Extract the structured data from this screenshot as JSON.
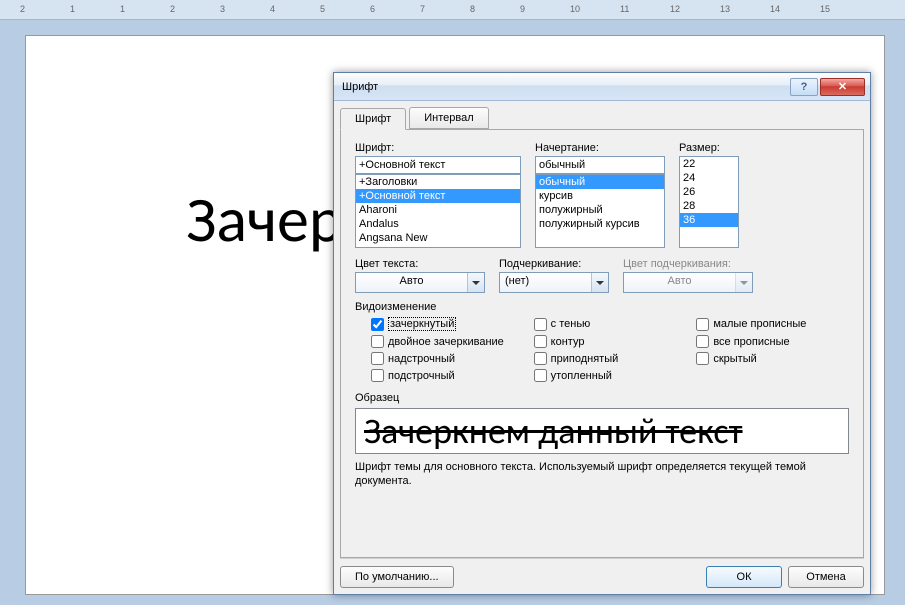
{
  "ruler": [
    "2",
    "1",
    "1",
    "2",
    "3",
    "4",
    "5",
    "6",
    "7",
    "8",
    "9",
    "10",
    "11",
    "12",
    "13",
    "14",
    "15"
  ],
  "doc_text": "Зачер                                    т.",
  "dialog": {
    "title": "Шрифт",
    "tabs": {
      "font": "Шрифт",
      "interval": "Интервал"
    },
    "labels": {
      "font": "Шрифт:",
      "style": "Начертание:",
      "size": "Размер:",
      "color": "Цвет текста:",
      "underline": "Подчеркивание:",
      "ucolor": "Цвет подчеркивания:",
      "effects": "Видоизменение",
      "sample": "Образец"
    },
    "font_value": "+Основной текст",
    "style_value": "обычный",
    "font_list": [
      "+Заголовки",
      "+Основной текст",
      "Aharoni",
      "Andalus",
      "Angsana New"
    ],
    "font_selected": "+Основной текст",
    "style_list": [
      "обычный",
      "курсив",
      "полужирный",
      "полужирный курсив"
    ],
    "style_selected": "обычный",
    "size_list": [
      "22",
      "24",
      "26",
      "28",
      "36"
    ],
    "size_selected": "36",
    "color_value": "Авто",
    "underline_value": "(нет)",
    "ucolor_value": "Авто",
    "effects": {
      "strike": "зачеркнутый",
      "dstrike": "двойное зачеркивание",
      "super": "надстрочный",
      "sub": "подстрочный",
      "shadow": "с тенью",
      "outline": "контур",
      "emboss": "приподнятый",
      "engrave": "утопленный",
      "smallcaps": "малые прописные",
      "allcaps": "все прописные",
      "hidden": "скрытый"
    },
    "sample_text": "Зачеркнем данный текст",
    "desc": "Шрифт темы для основного текста. Используемый шрифт определяется текущей темой документа.",
    "buttons": {
      "default": "По умолчанию...",
      "ok": "ОК",
      "cancel": "Отмена"
    }
  }
}
